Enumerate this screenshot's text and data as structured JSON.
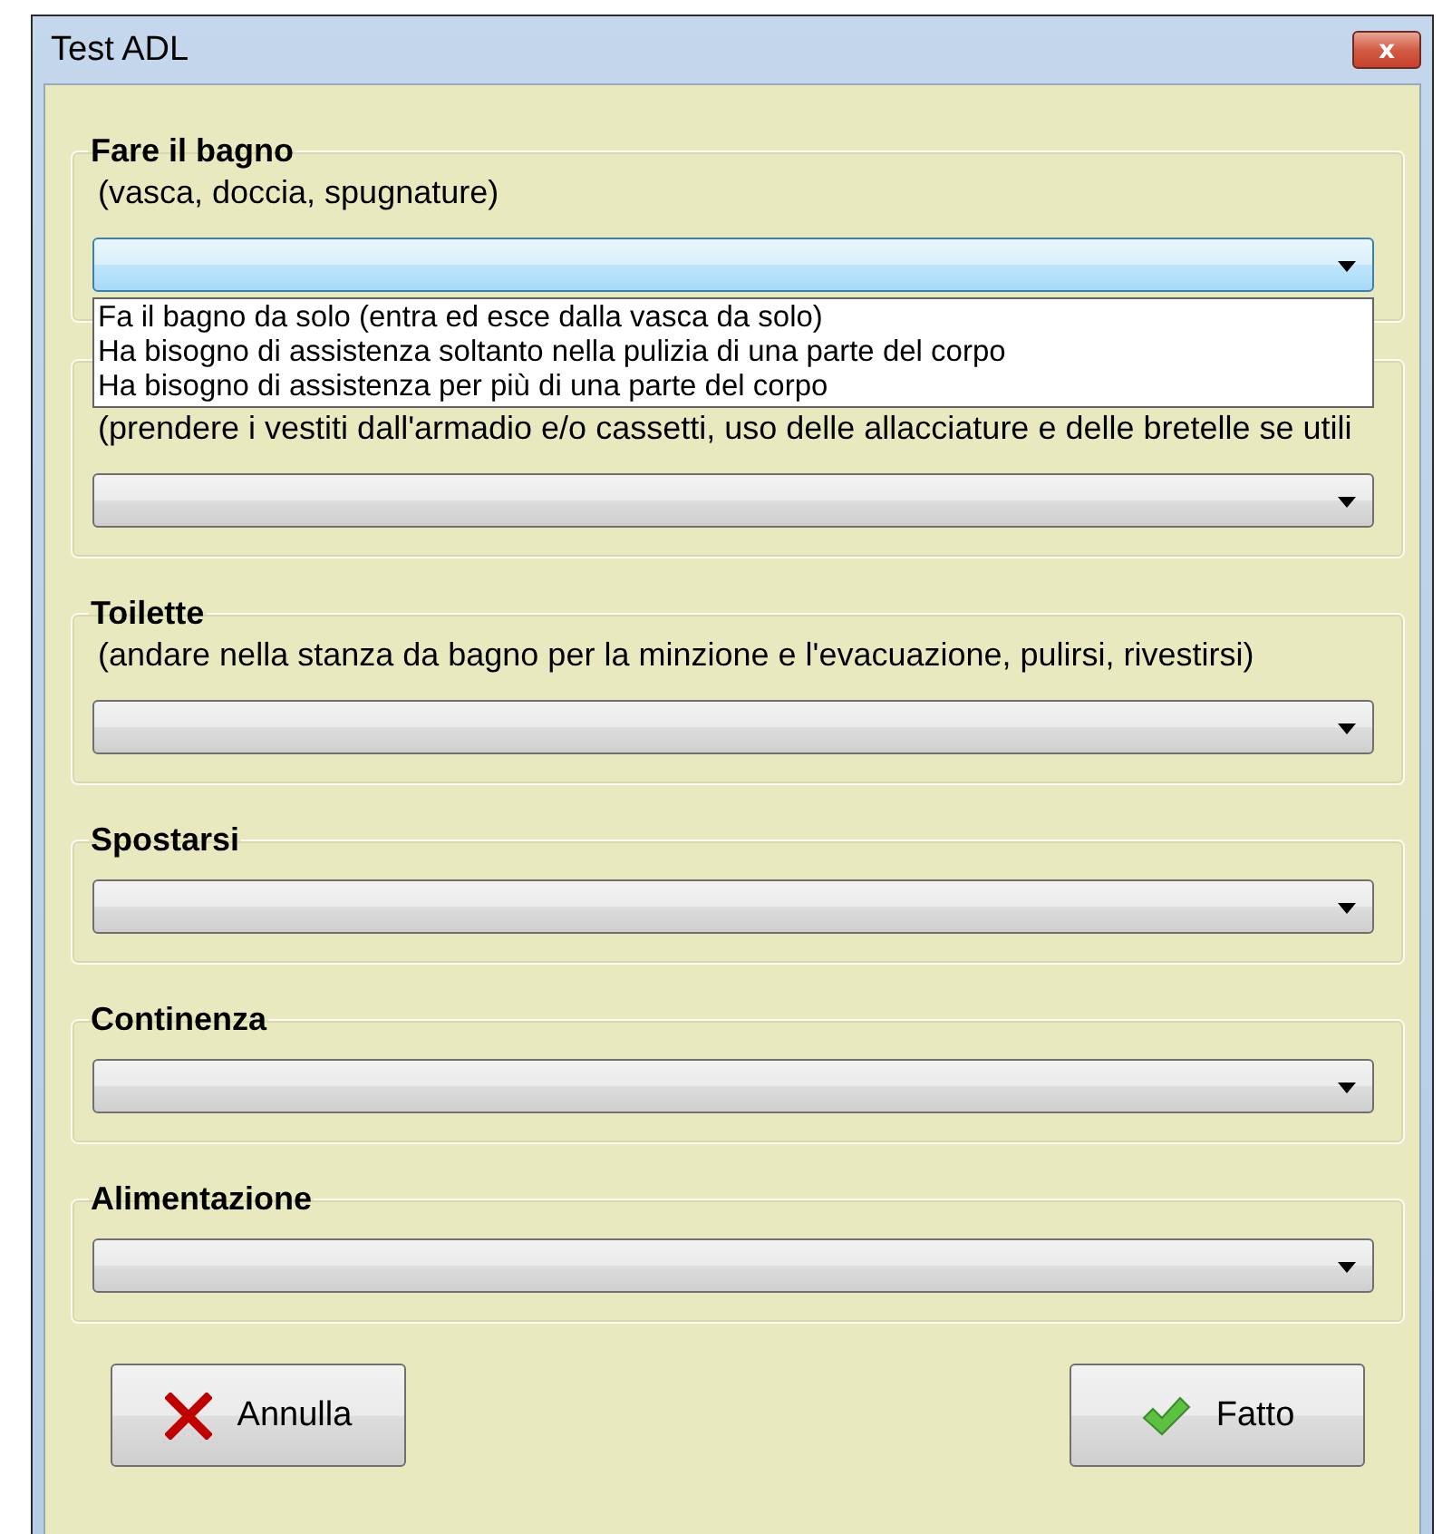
{
  "window": {
    "title": "Test ADL",
    "close_label": "x"
  },
  "groups": [
    {
      "title": "Fare il bagno",
      "description": "(vasca, doccia, spugnature)",
      "combo": {
        "expanded": true,
        "options": [
          "Fa il bagno da solo (entra ed esce dalla vasca da solo)",
          "Ha bisogno di assistenza soltanto nella pulizia di una parte del corpo",
          "Ha bisogno di assistenza per più di una parte del corpo"
        ]
      }
    },
    {
      "description": "(prendere i vestiti dall'armadio e/o cassetti, uso delle allacciature e delle bretelle se utili",
      "combo": {
        "expanded": false
      }
    },
    {
      "title": "Toilette",
      "description": "(andare nella stanza da bagno per la minzione e l'evacuazione, pulirsi, rivestirsi)",
      "combo": {
        "expanded": false
      }
    },
    {
      "title": "Spostarsi",
      "combo": {
        "expanded": false
      }
    },
    {
      "title": "Continenza",
      "combo": {
        "expanded": false
      }
    },
    {
      "title": "Alimentazione",
      "combo": {
        "expanded": false
      }
    }
  ],
  "buttons": [
    {
      "kind": "cancel",
      "label": "Annulla"
    },
    {
      "kind": "ok",
      "label": "Fatto"
    }
  ]
}
